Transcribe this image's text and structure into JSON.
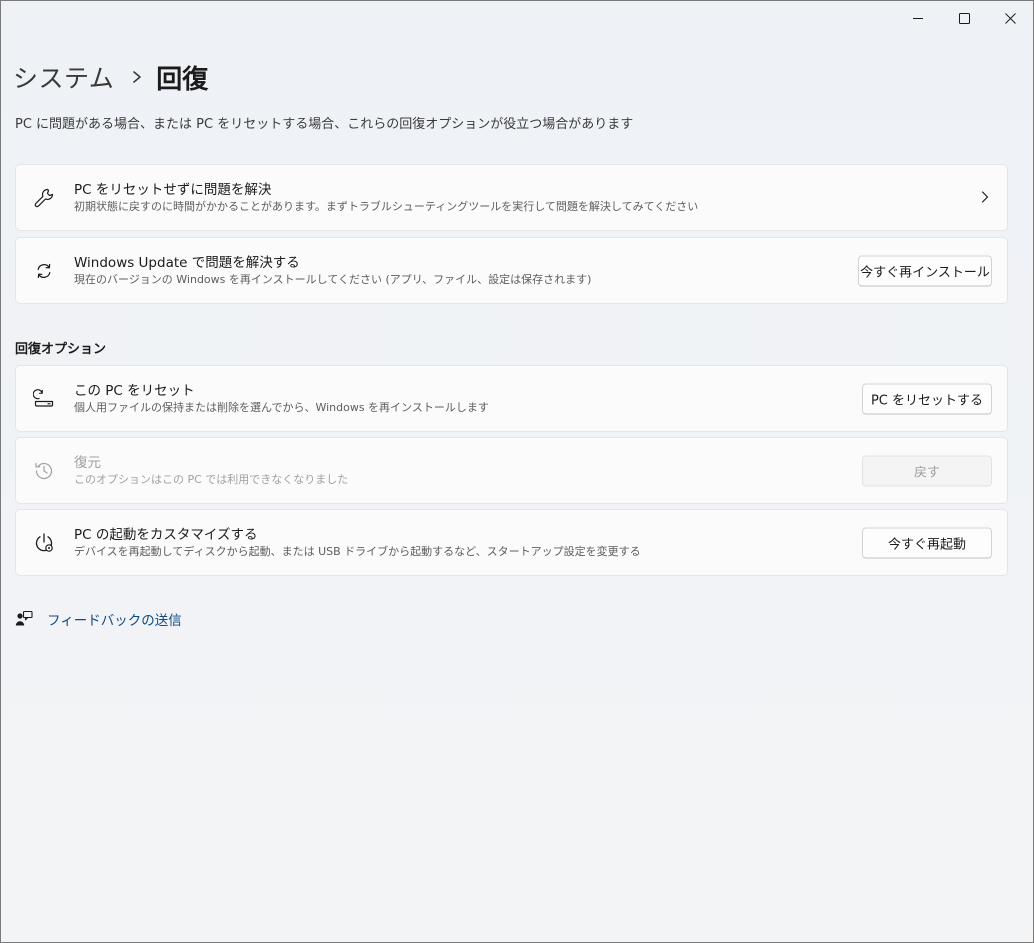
{
  "breadcrumb": {
    "parent": "システム",
    "current": "回復"
  },
  "description": "PC に問題がある場合、または PC をリセットする場合、これらの回復オプションが役立つ場合があります",
  "cards": {
    "troubleshoot": {
      "icon": "wrench-icon",
      "title": "PC をリセットせずに問題を解決",
      "subtitle": "初期状態に戻すのに時間がかかることがあります。まずトラブルシューティングツールを実行して問題を解決してみてください"
    },
    "windows_update": {
      "icon": "sync-icon",
      "title": "Windows Update で問題を解決する",
      "subtitle": "現在のバージョンの Windows を再インストールしてください (アプリ、ファイル、設定は保存されます)",
      "button": "今すぐ再インストール"
    }
  },
  "section_heading": "回復オプション",
  "options": {
    "reset": {
      "icon": "reset-pc-icon",
      "title": "この PC をリセット",
      "subtitle": "個人用ファイルの保持または削除を選んでから、Windows を再インストールします",
      "button": "PC をリセットする"
    },
    "go_back": {
      "icon": "history-icon",
      "title": "復元",
      "subtitle": "このオプションはこの PC では利用できなくなりました",
      "button": "戻す"
    },
    "advanced_startup": {
      "icon": "advanced-startup-icon",
      "title": "PC の起動をカスタマイズする",
      "subtitle": "デバイスを再起動してディスクから起動、または USB ドライブから起動するなど、スタートアップ設定を変更する",
      "button": "今すぐ再起動"
    }
  },
  "feedback": {
    "icon": "feedback-icon",
    "label": "フィードバックの送信"
  },
  "colors": {
    "accent_link": "#0f4a84",
    "card_bg": "#fbfbfc",
    "disabled_text": "#a0a0a0"
  }
}
